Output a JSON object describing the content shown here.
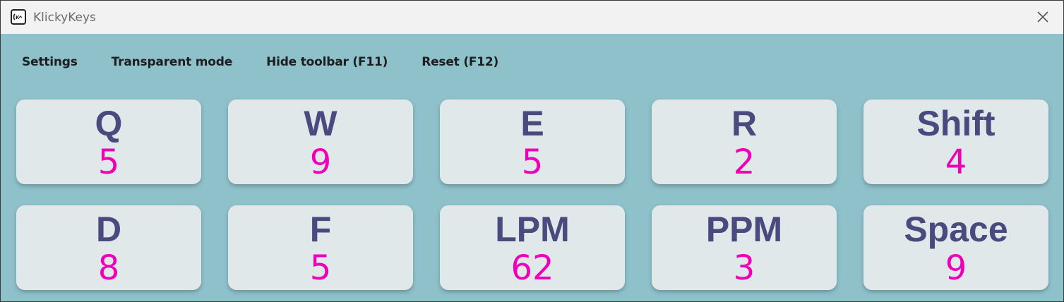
{
  "window": {
    "title": "KlickyKeys",
    "icon": "klickykeys-app-icon",
    "close_icon": "close-icon"
  },
  "toolbar": {
    "items": [
      {
        "label": "Settings"
      },
      {
        "label": "Transparent mode"
      },
      {
        "label": "Hide toolbar (F11)"
      },
      {
        "label": "Reset (F12)"
      }
    ]
  },
  "keys": [
    {
      "label": "Q",
      "count": "5"
    },
    {
      "label": "W",
      "count": "9"
    },
    {
      "label": "E",
      "count": "5"
    },
    {
      "label": "R",
      "count": "2"
    },
    {
      "label": "Shift",
      "count": "4"
    },
    {
      "label": "D",
      "count": "8"
    },
    {
      "label": "F",
      "count": "5"
    },
    {
      "label": "LPM",
      "count": "62"
    },
    {
      "label": "PPM",
      "count": "3"
    },
    {
      "label": "Space",
      "count": "9"
    }
  ],
  "colors": {
    "background": "#8fc1cb",
    "key_background": "#e1e8ea",
    "key_label": "#4a4a7e",
    "key_count": "#ee00b8",
    "titlebar": "#f2f2f2"
  }
}
